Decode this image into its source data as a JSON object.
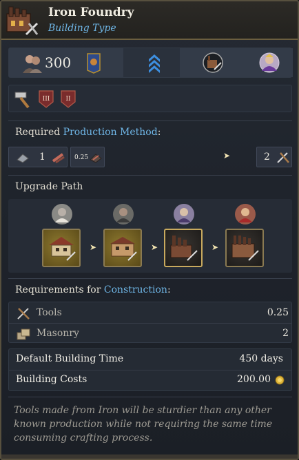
{
  "header": {
    "title": "Iron Foundry",
    "subtitle": "Building Type",
    "icon": "iron-foundry-icon"
  },
  "summary_strip": {
    "population": "300",
    "icons": [
      "population-icon",
      "banner-icon",
      "chevron-up-icon",
      "workshop-icon",
      "aristocrat-icon"
    ]
  },
  "attributes": {
    "icons": [
      "hammer-icon",
      "tier-iii-badge-icon",
      "tier-ii-badge-icon"
    ],
    "badge_labels": [
      "III",
      "II"
    ]
  },
  "production": {
    "heading_prefix": "Required ",
    "heading_link": "Production Method",
    "heading_suffix": ":",
    "inputs": [
      {
        "icon": "iron-icon",
        "amount": "1"
      },
      {
        "icon": "wood-icon",
        "amount": "0.25"
      }
    ],
    "output": {
      "icon": "tools-icon",
      "amount": "2"
    }
  },
  "upgrade": {
    "heading": "Upgrade Path",
    "stages": [
      {
        "pop_icon": "peasant-icon",
        "style": "gold",
        "selected": false
      },
      {
        "pop_icon": "worker-icon",
        "style": "gold",
        "selected": false
      },
      {
        "pop_icon": "burgher-icon",
        "style": "dark",
        "selected": true
      },
      {
        "pop_icon": "noble-icon",
        "style": "dark",
        "selected": false
      }
    ]
  },
  "requirements": {
    "heading_prefix": "Requirements for ",
    "heading_link": "Construction",
    "heading_suffix": ":",
    "items": [
      {
        "icon": "tools-icon",
        "name": "Tools",
        "value": "0.25"
      },
      {
        "icon": "masonry-icon",
        "name": "Masonry",
        "value": "2"
      }
    ]
  },
  "costs": {
    "time_label": "Default Building Time",
    "time_value": "450 days",
    "cost_label": "Building Costs",
    "cost_value": "200.00",
    "cost_icon": "gold-coin-icon"
  },
  "description": "Tools made from Iron will be sturdier than any other known production while not requiring the same time consuming crafting process.",
  "colors": {
    "accent_blue": "#6fb6e6",
    "panel_border": "#57503e",
    "gold": "#c9aa5e"
  }
}
